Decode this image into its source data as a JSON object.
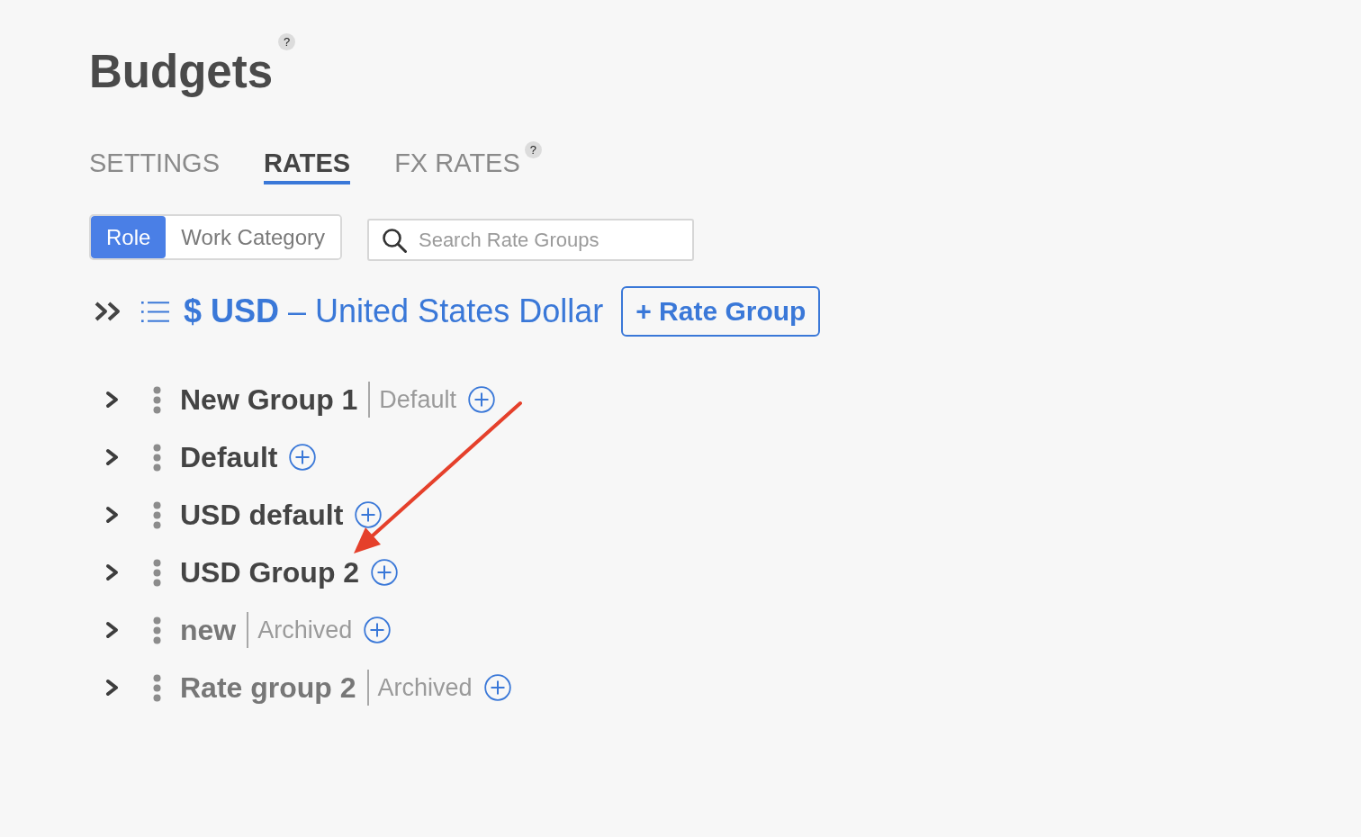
{
  "page": {
    "title": "Budgets",
    "title_help": "?"
  },
  "tabs": [
    {
      "label": "SETTINGS",
      "selected": false
    },
    {
      "label": "RATES",
      "selected": true
    },
    {
      "label": "FX RATES",
      "selected": false,
      "help": "?"
    }
  ],
  "view_toggle": [
    {
      "label": "Role",
      "selected": true
    },
    {
      "label": "Work Category",
      "selected": false
    }
  ],
  "search": {
    "placeholder": "Search Rate Groups"
  },
  "currency": {
    "title": "**$ USD** – United States Dollar",
    "add_button": "+ Rate Group"
  },
  "rate_groups": [
    {
      "name": "New Group 1",
      "tag": "Default",
      "archived": false,
      "expanded": false
    },
    {
      "name": "Default",
      "archived": false,
      "expanded": false
    },
    {
      "name": "USD default",
      "archived": false,
      "expanded": false
    },
    {
      "name": "USD Group 2",
      "archived": false,
      "expanded": false
    },
    {
      "name": "new",
      "tag": "Archived",
      "archived": true,
      "expanded": false
    },
    {
      "name": "Rate group 2",
      "tag": "Archived",
      "archived": true,
      "expanded": false
    }
  ]
}
